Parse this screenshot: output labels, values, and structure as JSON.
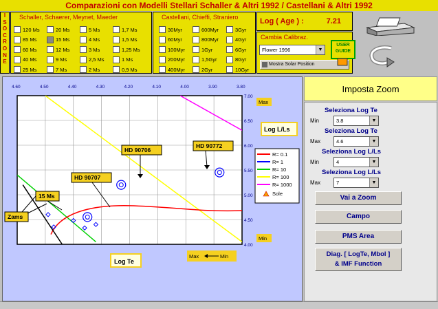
{
  "title": "Comparazioni con Modelli Stellari Schaller & Altri 1992 / Castellani & Altri 1992",
  "isocrone_label": [
    "I",
    "S",
    "O",
    "C",
    "R",
    "O",
    "N",
    "E"
  ],
  "schaller": {
    "title": "Schaller, Schaerer, Meynet, Maeder",
    "columns": [
      [
        "120 Ms",
        "85 Ms",
        "60 Ms",
        "40 Ms",
        "25 Ms"
      ],
      [
        "20 Ms",
        "15 Ms",
        "12 Ms",
        "9 Ms",
        "7 Ms"
      ],
      [
        "5 Ms",
        "4 Ms",
        "3 Ms",
        "2,5 Ms",
        "2 Ms"
      ],
      [
        "1,7 Ms",
        "1,5 Ms",
        "1,25 Ms",
        "1 Ms",
        "0,9 Ms"
      ]
    ]
  },
  "castellani": {
    "title": "Castellani, Chieffi, Straniero",
    "columns": [
      [
        "30Myr",
        "60Myr",
        "100Myr",
        "200Myr",
        "400Myr"
      ],
      [
        "600Myr",
        "800Myr",
        "1Gyr",
        "1,5Gyr",
        "2Gyr"
      ],
      [
        "3Gyr",
        "4Gyr",
        "6Gyr",
        "8Gyr",
        "10Gyr"
      ]
    ]
  },
  "log_age": {
    "label": "Log ( Age ) :",
    "value": "7.21"
  },
  "calibrazione": {
    "label": "Cambia Calibraz.",
    "selected": "Flower 1996",
    "mostra_label": "Mostra Solar Position"
  },
  "user_guide": "USER GUIDE",
  "chart_data": {
    "type": "scatter",
    "x_ticks": [
      "4.60",
      "4.50",
      "4.40",
      "4.30",
      "4.20",
      "4.10",
      "4.00",
      "3.90",
      "3.80"
    ],
    "y_ticks": [
      "7.00",
      "6.50",
      "6.00",
      "5.50",
      "5.00",
      "4.50",
      "4.00"
    ],
    "xlim": [
      4.6,
      3.8
    ],
    "ylim": [
      4.0,
      7.0
    ],
    "stars": [
      {
        "name": "HD 90706",
        "logTe": 4.23,
        "logL": 5.2
      },
      {
        "name": "HD 90772",
        "logTe": 3.88,
        "logL": 5.45
      },
      {
        "name": "HD 90707",
        "logTe": 4.35,
        "logL": 4.55
      }
    ],
    "isocrone_points": [
      [
        4.49,
        4.6
      ],
      [
        4.47,
        4.35
      ],
      [
        4.4,
        4.48
      ],
      [
        4.36,
        4.33
      ],
      [
        4.32,
        4.4
      ]
    ],
    "radius_lines": [
      {
        "name": "R= 0.1",
        "color": "#ff0000"
      },
      {
        "name": "R= 1",
        "color": "#0000ff"
      },
      {
        "name": "R= 10",
        "color": "#00d000"
      },
      {
        "name": "R= 100",
        "color": "#ffff00"
      },
      {
        "name": "R= 1000",
        "color": "#ff00ff"
      }
    ],
    "sole_label": "Sole",
    "labels": {
      "zams": "Zams",
      "ms15": "15 Ms",
      "max": "Max",
      "min": "Min",
      "logl": "Log L/Ls",
      "logt": "Log Te",
      "maxmin": "Max",
      "maxmin_right": "Min"
    }
  },
  "zoom": {
    "title": "Imposta Zoom",
    "sel1": {
      "label": "Seleziona Log Te",
      "prefix": "Min",
      "value": "3.8"
    },
    "sel2": {
      "label": "Seleziona Log Te",
      "prefix": "Max",
      "value": "4.6"
    },
    "sel3": {
      "label": "Seleziona Log L/Ls",
      "prefix": "Min",
      "value": "4"
    },
    "sel4": {
      "label": "Seleziona Log L/Ls",
      "prefix": "Max",
      "value": "7"
    },
    "btn_vai": "Vai a Zoom",
    "btn_campo": "Campo",
    "btn_pms": "PMS Area",
    "btn_diag1": "Diag. [ LogTe, Mbol ]",
    "btn_diag2": "& IMF Function"
  }
}
